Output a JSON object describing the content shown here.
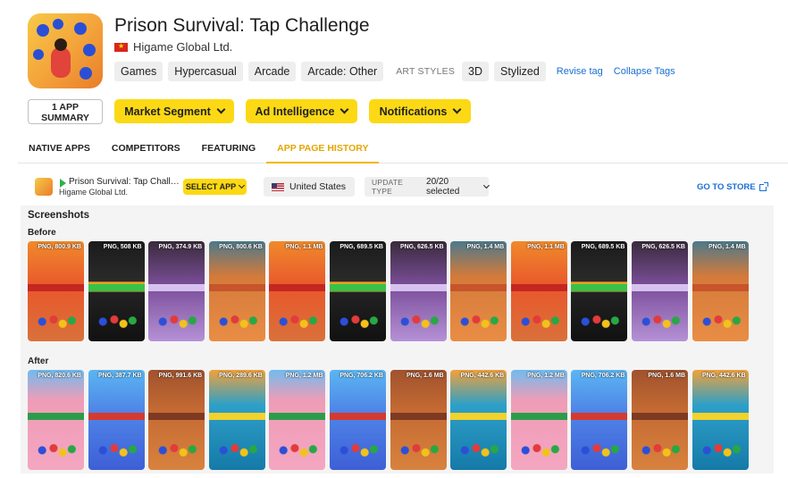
{
  "app": {
    "title": "Prison Survival: Tap Challenge",
    "developer": "Higame Global Ltd.",
    "tags": [
      "Games",
      "Hypercasual",
      "Arcade",
      "Arcade: Other"
    ],
    "art_styles_label": "ART STYLES",
    "art_styles": [
      "3D",
      "Stylized"
    ],
    "revise_tag": "Revise tag",
    "collapse_tags": "Collapse Tags"
  },
  "summary_button": {
    "line1": "1 APP",
    "line2": "SUMMARY"
  },
  "dropdowns": [
    "Market Segment",
    "Ad Intelligence",
    "Notifications"
  ],
  "tabs": [
    "NATIVE APPS",
    "COMPETITORS",
    "FEATURING",
    "APP PAGE HISTORY"
  ],
  "active_tab": "APP PAGE HISTORY",
  "filter": {
    "app_name": "Prison Survival: Tap Challen...",
    "app_dev": "Higame Global Ltd.",
    "select_app": "SELECT APP",
    "country": "United States",
    "update_type_label": "UPDATE TYPE",
    "update_type_value": "20/20 selected",
    "go_to_store": "GO TO STORE"
  },
  "screenshots": {
    "title": "Screenshots",
    "before_label": "Before",
    "after_label": "After",
    "before": [
      {
        "badge": "PNG, 800.9 KB",
        "theme": "orange"
      },
      {
        "badge": "PNG, 508 KB",
        "theme": "dark"
      },
      {
        "badge": "PNG, 374.9 KB",
        "theme": "purple"
      },
      {
        "badge": "PNG, 800.6 KB",
        "theme": "field"
      },
      {
        "badge": "PNG, 1.1 MB",
        "theme": "orange"
      },
      {
        "badge": "PNG, 689.5 KB",
        "theme": "dark"
      },
      {
        "badge": "PNG, 626.5 KB",
        "theme": "purple"
      },
      {
        "badge": "PNG, 1.4 MB",
        "theme": "field"
      },
      {
        "badge": "PNG, 1.1 MB",
        "theme": "orange"
      },
      {
        "badge": "PNG, 689.5 KB",
        "theme": "dark"
      },
      {
        "badge": "PNG, 626.5 KB",
        "theme": "purple"
      },
      {
        "badge": "PNG, 1.4 MB",
        "theme": "field"
      }
    ],
    "after": [
      {
        "badge": "PNG, 820.6 KB",
        "theme": "pink"
      },
      {
        "badge": "PNG, 387.7 KB",
        "theme": "blue"
      },
      {
        "badge": "PNG, 991.6 KB",
        "theme": "clay"
      },
      {
        "badge": "PNG, 289.6 KB",
        "theme": "sea"
      },
      {
        "badge": "PNG, 1.2 MB",
        "theme": "pink"
      },
      {
        "badge": "PNG, 706.2 KB",
        "theme": "blue"
      },
      {
        "badge": "PNG, 1.6 MB",
        "theme": "clay"
      },
      {
        "badge": "PNG, 442.6 KB",
        "theme": "sea"
      },
      {
        "badge": "PNG, 1.2 MB",
        "theme": "pink"
      },
      {
        "badge": "PNG, 706.2 KB",
        "theme": "blue"
      },
      {
        "badge": "PNG, 1.6 MB",
        "theme": "clay"
      },
      {
        "badge": "PNG, 442.6 KB",
        "theme": "sea"
      }
    ]
  },
  "colors": {
    "accent_yellow": "#fcd914",
    "active_tab": "#e3a605",
    "link_blue": "#1a6fd1"
  }
}
